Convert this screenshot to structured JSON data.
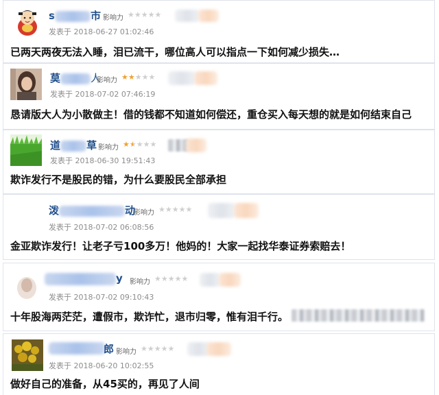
{
  "influence_label": "影响力",
  "comments": [
    {
      "username_prefix": "s",
      "username_suffix": "市",
      "stars": 0,
      "date": "发表于 2018-06-27 01:02:46",
      "text": "已两天两夜无法入睡，泪已流干，哪位高人可以指点一下如何减少损失…",
      "avatar": "cartoon-god-of-wealth"
    },
    {
      "username_prefix": "莫",
      "username_suffix": "人",
      "stars": 2,
      "date": "发表于 2018-07-02 07:46:19",
      "text": "恳请版大人为小散做主！借的钱都不知道如何偿还，重仓买入每天想的就是如何结束自己",
      "avatar": "woman-photo"
    },
    {
      "username_prefix": "道",
      "username_suffix": "草",
      "stars": 1.5,
      "date": "发表于 2018-06-30 19:51:43",
      "text": "欺诈发行不是股民的错，为什么要股民全部承担",
      "avatar": "green-grass"
    },
    {
      "username_prefix": "泼",
      "username_suffix": "动",
      "stars": 0,
      "date": "发表于 2018-07-02 06:08:56",
      "text": "金亚欺诈发行！让老子亏100多万！他妈的！大家一起找华泰证券索赔去！",
      "avatar": "none"
    },
    {
      "username_prefix": "",
      "username_suffix": "y",
      "stars": 0,
      "date": "发表于 2018-07-02 09:10:43",
      "text": "十年股海两茫茫，遭假市，欺诈忙，退市归零，惟有泪千行。",
      "avatar": "blurred-photo"
    },
    {
      "username_prefix": "",
      "username_suffix": "郎",
      "stars": 0,
      "date": "发表于 2018-06-20 10:02:55",
      "text": "做好自己的准备，从45买的，再见了人间",
      "avatar": "yellow-flowers"
    }
  ]
}
